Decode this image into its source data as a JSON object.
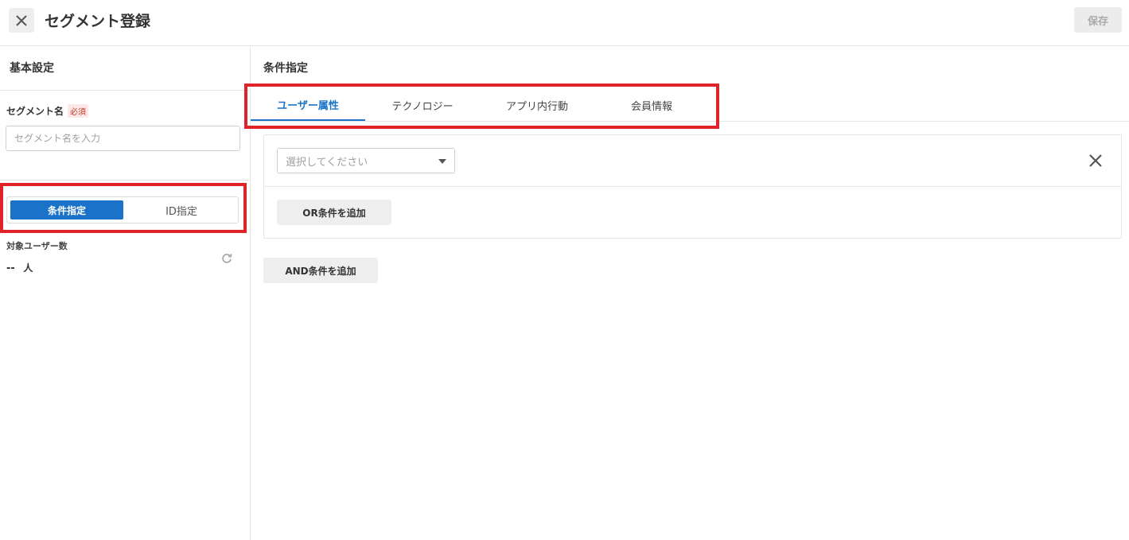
{
  "header": {
    "title": "セグメント登録",
    "save_label": "保存",
    "close_icon": "close-icon"
  },
  "sidebar": {
    "section_title": "基本設定",
    "segment_name_label": "セグメント名",
    "required_badge": "必須",
    "segment_name_placeholder": "セグメント名を入力",
    "segment_name_value": "",
    "mode_options": [
      "条件指定",
      "ID指定"
    ],
    "mode_selected": "条件指定",
    "target_users_label": "対象ユーザー数",
    "target_users_value": "--",
    "target_users_unit": "人",
    "refresh_icon": "refresh-icon"
  },
  "main": {
    "title": "条件指定",
    "tabs": [
      {
        "label": "ユーザー属性",
        "active": true
      },
      {
        "label": "テクノロジー",
        "active": false
      },
      {
        "label": "アプリ内行動",
        "active": false
      },
      {
        "label": "会員情報",
        "active": false
      }
    ],
    "condition": {
      "select_placeholder": "選択してください",
      "remove_icon": "close-icon",
      "or_button_label": "OR条件を追加"
    },
    "and_button_label": "AND条件を追加"
  },
  "colors": {
    "accent": "#1a73c8",
    "highlight": "#e0222b"
  }
}
